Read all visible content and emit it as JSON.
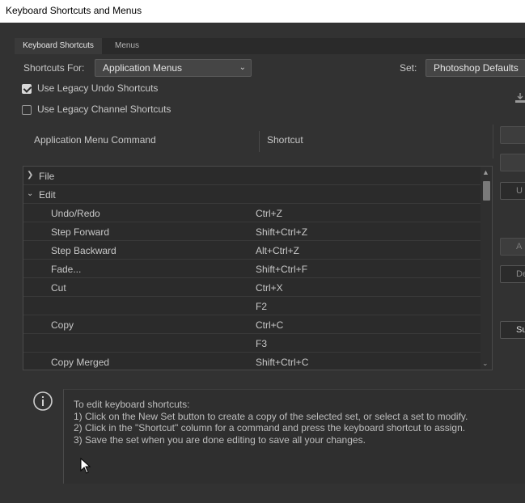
{
  "window": {
    "title": "Keyboard Shortcuts and Menus"
  },
  "tabs": [
    {
      "label": "Keyboard Shortcuts",
      "active": true
    },
    {
      "label": "Menus",
      "active": false
    }
  ],
  "shortcuts_for": {
    "label": "Shortcuts For:",
    "value": "Application Menus"
  },
  "set": {
    "label": "Set:",
    "value": "Photoshop Defaults"
  },
  "options": [
    {
      "label": "Use Legacy Undo Shortcuts",
      "checked": true
    },
    {
      "label": "Use Legacy Channel Shortcuts",
      "checked": false
    }
  ],
  "table": {
    "headers": {
      "command": "Application Menu Command",
      "shortcut": "Shortcut"
    },
    "rows": [
      {
        "command": "File",
        "shortcut": "",
        "level": 0,
        "expanded": false
      },
      {
        "command": "Edit",
        "shortcut": "",
        "level": 0,
        "expanded": true
      },
      {
        "command": "Undo/Redo",
        "shortcut": "Ctrl+Z",
        "level": 1
      },
      {
        "command": "Step Forward",
        "shortcut": "Shift+Ctrl+Z",
        "level": 1
      },
      {
        "command": "Step Backward",
        "shortcut": "Alt+Ctrl+Z",
        "level": 1
      },
      {
        "command": "Fade...",
        "shortcut": "Shift+Ctrl+F",
        "level": 1
      },
      {
        "command": "Cut",
        "shortcut": "Ctrl+X",
        "level": 1
      },
      {
        "command": "",
        "shortcut": "F2",
        "level": 1
      },
      {
        "command": "Copy",
        "shortcut": "Ctrl+C",
        "level": 1
      },
      {
        "command": "",
        "shortcut": "F3",
        "level": 1
      },
      {
        "command": "Copy Merged",
        "shortcut": "Shift+Ctrl+C",
        "level": 1
      }
    ]
  },
  "side_buttons": {
    "undo": "U",
    "add": "A",
    "delete": "De",
    "summarize": "Su"
  },
  "info": {
    "heading": "To edit keyboard shortcuts:",
    "steps": [
      "1) Click on the New Set button to create a copy of the selected set, or select a set to modify.",
      "2) Click in the \"Shortcut\" column for a command and press the keyboard shortcut to assign.",
      "3) Save the set when you are done editing to save all your changes."
    ]
  },
  "icons": {
    "dropdown": "chevron-down-icon",
    "collapsed": "chevron-right-icon",
    "expanded": "chevron-down-icon",
    "info": "info-icon",
    "save": "save-set-icon",
    "cursor": "mouse-pointer-icon"
  },
  "colors": {
    "background": "#323232",
    "panel": "#2b2b2b",
    "text": "#c8c8c8",
    "titlebar": "#ffffff"
  }
}
